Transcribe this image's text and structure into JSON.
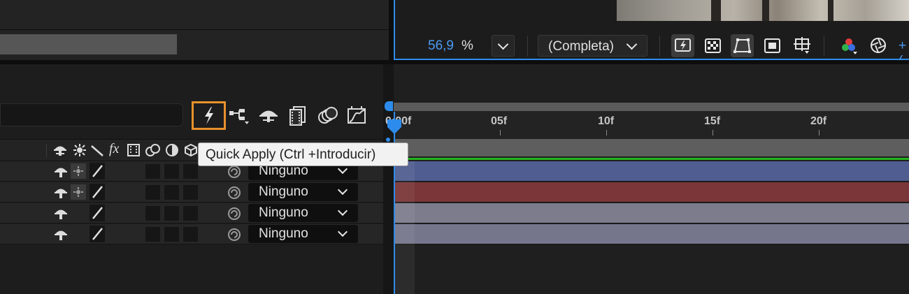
{
  "composition_viewer": {
    "zoom_value": "56,9",
    "zoom_unit": "%",
    "resolution": "(Completa)",
    "partial_label": "+(",
    "accent_color": "#2d8ceb"
  },
  "timeline": {
    "quick_apply_tooltip": "Quick Apply (Ctrl +Introducir)",
    "quick_apply_highlight_color": "#e8912c",
    "ruler_labels": [
      "0:00f",
      "05f",
      "10f",
      "15f",
      "20f"
    ],
    "fx_label": "fx",
    "layers": [
      {
        "parent": "Ninguno",
        "color": "#4f5d90"
      },
      {
        "parent": "Ninguno",
        "color": "#7a3638"
      },
      {
        "parent": "Ninguno",
        "color": "#7c7c8d"
      },
      {
        "parent": "Ninguno",
        "color": "#75758b"
      }
    ],
    "work_area_color": "#22b41e"
  },
  "icons": [
    "quick-apply-icon",
    "flowchart-icon",
    "solo-icon",
    "frame-blending-icon",
    "motion-blur-icon",
    "graph-editor-icon",
    "checkerboard-icon",
    "mask-icon",
    "region-icon",
    "grid-icon",
    "color-channels-icon",
    "exposure-icon"
  ]
}
